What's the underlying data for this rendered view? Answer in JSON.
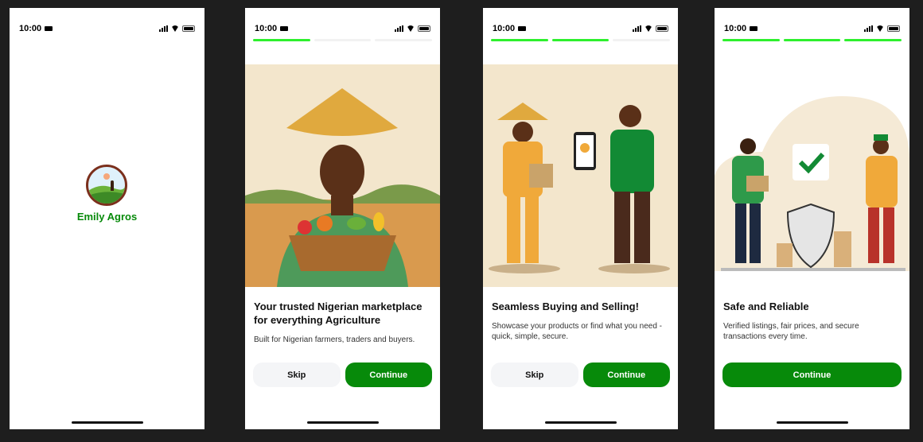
{
  "status_bar": {
    "time": "10:00"
  },
  "splash": {
    "brand": "Emily Agros"
  },
  "onboarding": [
    {
      "step": 1,
      "progress": [
        true,
        false,
        false
      ],
      "title": "Your trusted Nigerian marketplace for everything Agriculture",
      "subtitle": "Built for Nigerian farmers, traders and buyers.",
      "skip": "Skip",
      "continue": "Continue"
    },
    {
      "step": 2,
      "progress": [
        true,
        true,
        false
      ],
      "title": "Seamless Buying and Selling!",
      "subtitle": "Showcase your products or find what you need - quick, simple, secure.",
      "skip": "Skip",
      "continue": "Continue"
    },
    {
      "step": 3,
      "progress": [
        true,
        true,
        true
      ],
      "title": "Safe and Reliable",
      "subtitle": "Verified listings, fair prices, and secure transactions every time.",
      "continue": "Continue"
    }
  ],
  "colors": {
    "primary": "#078a0a",
    "progress": "#2ef02e",
    "canvas": "#1e1e1e"
  }
}
